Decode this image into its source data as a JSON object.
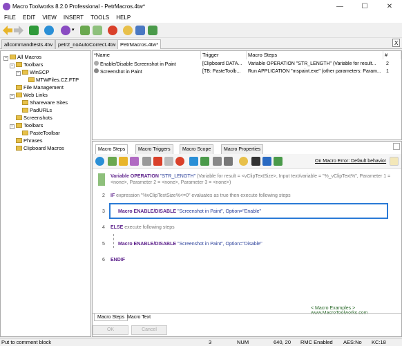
{
  "window": {
    "title": "Macro Toolworks 8.2.0 Professional - PetrMacros.4tw*",
    "minimize": "—",
    "maximize": "☐",
    "close": "✕"
  },
  "menu": [
    "FILE",
    "EDIT",
    "VIEW",
    "INSERT",
    "TOOLS",
    "HELP"
  ],
  "doc_tabs": [
    "allcommandtests.4tw",
    "petr2_noAutoCorrect.4tw",
    "PetrMacros.4tw*"
  ],
  "doc_close": "X",
  "tree": [
    {
      "label": "All Macros",
      "level": 0,
      "exp": "−"
    },
    {
      "label": "Toolbars",
      "level": 1,
      "exp": "−"
    },
    {
      "label": "WinSCP",
      "level": 2,
      "exp": "−"
    },
    {
      "label": "MTWFiles.CZ.FTP",
      "level": 3,
      "exp": ""
    },
    {
      "label": "File Management",
      "level": 1,
      "exp": ""
    },
    {
      "label": "Web Links",
      "level": 1,
      "exp": "−"
    },
    {
      "label": "Shareware Sites",
      "level": 2,
      "exp": ""
    },
    {
      "label": "PadURLs",
      "level": 2,
      "exp": ""
    },
    {
      "label": "Screenshots",
      "level": 1,
      "exp": ""
    },
    {
      "label": "Toolbars",
      "level": 1,
      "exp": "−"
    },
    {
      "label": "PasteToolbar",
      "level": 2,
      "exp": ""
    },
    {
      "label": "Phrases",
      "level": 1,
      "exp": ""
    },
    {
      "label": "Clipboard Macros",
      "level": 1,
      "exp": ""
    }
  ],
  "list": {
    "headers": [
      "*Name",
      "Trigger",
      "Macro Steps",
      "#"
    ],
    "rows": [
      [
        "Enable/Disable Screenshot in Paint",
        "[Clipboard DATA...",
        "Variable OPERATION \"STR_LENGTH\" (Variable for result...",
        "2"
      ],
      [
        "Screenshot in Paint",
        "[TB: PasteToolb...",
        "Run APPLICATION \"mspaint.exe\" (other parameters: Param...",
        "1"
      ]
    ]
  },
  "sub_tabs": [
    "Macro Steps",
    "Macro Triggers",
    "Macro Scope",
    "Macro Properties"
  ],
  "on_error": "On Macro Error: Default behavior",
  "steps": {
    "s1_kw": "Variable OPERATION",
    "s1_str": " \"STR_LENGTH\" ",
    "s1_rest": "(Variable for result = <vClipTextSize>, Input text/variable = \"%_vClipText%\", Parameter 1 =",
    "s1_rest2": "<none>, Parameter 2 = <none>, Parameter 3 = <none>)",
    "s2_kw": "IF",
    "s2_rest": " expression \"%vClipTextSize%<=0\" evaluates as true then execute following steps",
    "s3_kw": "Macro ENABLE/DISABLE",
    "s3_rest": " \"Screenshot in Paint\", Option=\"Enable\"",
    "s4_kw": "ELSE",
    "s4_rest": " execute following steps",
    "s5_kw": "Macro ENABLE/DISABLE",
    "s5_rest": " \"Screenshot in Paint\", Option=\"Disable\"",
    "s6_kw": "ENDIF",
    "nums": [
      "1",
      "2",
      "3",
      "4",
      "5",
      "6"
    ]
  },
  "macro_links": "< Macro Examples > www.MacroToolworks.com",
  "bottom_tabs": [
    "Macro Steps",
    "Macro Text"
  ],
  "buttons": {
    "ok": "OK",
    "cancel": "Cancel"
  },
  "status": {
    "left": "Put to comment block",
    "s1": "3",
    "s2": "NUM",
    "s3": "640, 20",
    "s4": "RMC Enabled",
    "s5": "AES:No",
    "s6": "KC:18"
  }
}
